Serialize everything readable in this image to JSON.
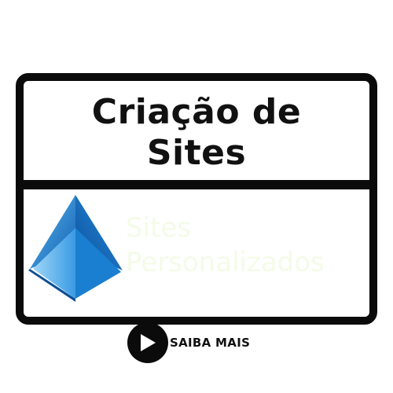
{
  "card": {
    "title_line1": "Criação de",
    "title_line2": "Sites"
  },
  "content": {
    "logo_icon": "blue-pyramid-logo",
    "subtitle_line1": "Sites",
    "subtitle_line2": "Personalizados"
  },
  "cta": {
    "icon": "play-arrow-icon",
    "label": "SAIBA MAIS"
  },
  "colors": {
    "frame": "#0b0b0b",
    "logo_blue": "#1a7fd0",
    "subtitle": "#f4fbe8"
  }
}
